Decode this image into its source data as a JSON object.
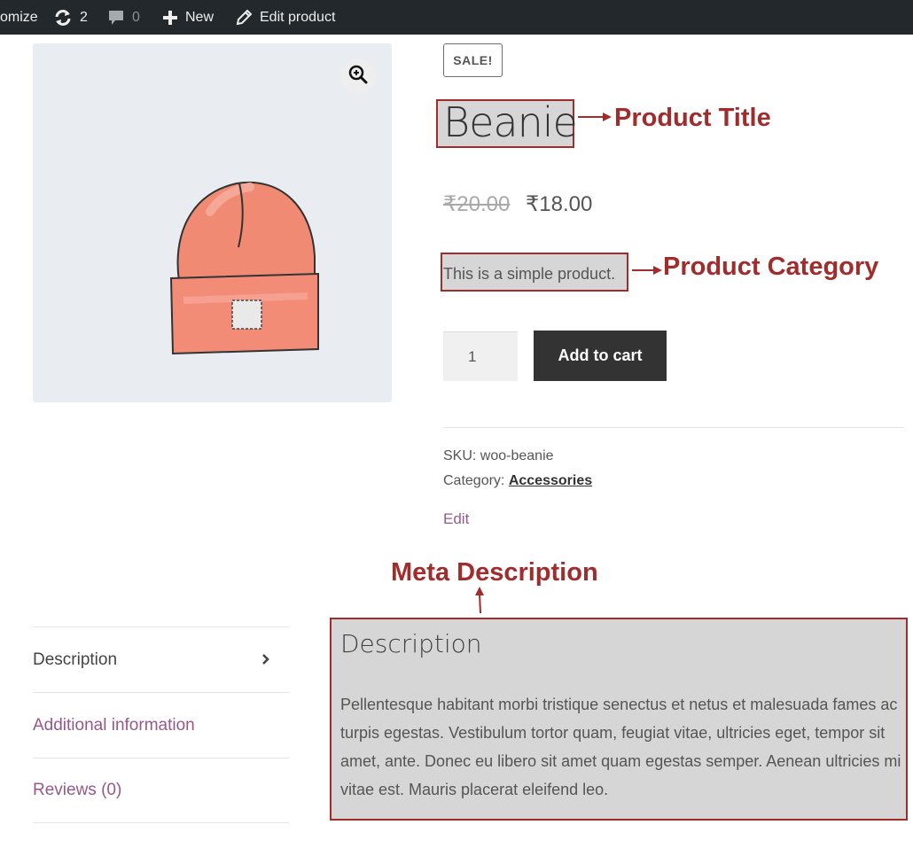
{
  "admin_bar": {
    "customize_label": "omize",
    "updates_count": "2",
    "comments_count": "0",
    "new_label": "New",
    "edit_label": "Edit product"
  },
  "product": {
    "sale_badge": "SALE!",
    "title": "Beanie",
    "price_regular": "₹20.00",
    "price_sale": "₹18.00",
    "short_description": "This is a simple product.",
    "quantity": "1",
    "add_to_cart_label": "Add to cart",
    "sku_label": "SKU: woo-beanie",
    "category_prefix": "Category:",
    "category_link": "Accessories",
    "edit_link": "Edit"
  },
  "annotations": {
    "product_title": "Product Title",
    "product_category": "Product Category",
    "meta_description": "Meta Description"
  },
  "tabs": [
    {
      "label": "Description",
      "active": true
    },
    {
      "label": "Additional information",
      "active": false
    },
    {
      "label": "Reviews (0)",
      "active": false
    }
  ],
  "description": {
    "heading": "Description",
    "body": "Pellentesque habitant morbi tristique senectus et netus et malesuada fames ac turpis egestas. Vestibulum tortor quam, feugiat vitae, ultricies eget, tempor sit amet, ante. Donec eu libero sit amet quam egestas semper. Aenean ultricies mi vitae est. Mauris placerat eleifend leo."
  },
  "colors": {
    "admin_bar_bg": "#23282d",
    "annotation_red": "#a02c2c",
    "link_purple": "#96588a",
    "button_dark": "#333333",
    "highlight_gray": "#d6d6d6"
  },
  "icons": [
    "updates-icon",
    "comments-icon",
    "plus-icon",
    "pencil-icon",
    "zoom-icon",
    "chevron-right-icon"
  ]
}
